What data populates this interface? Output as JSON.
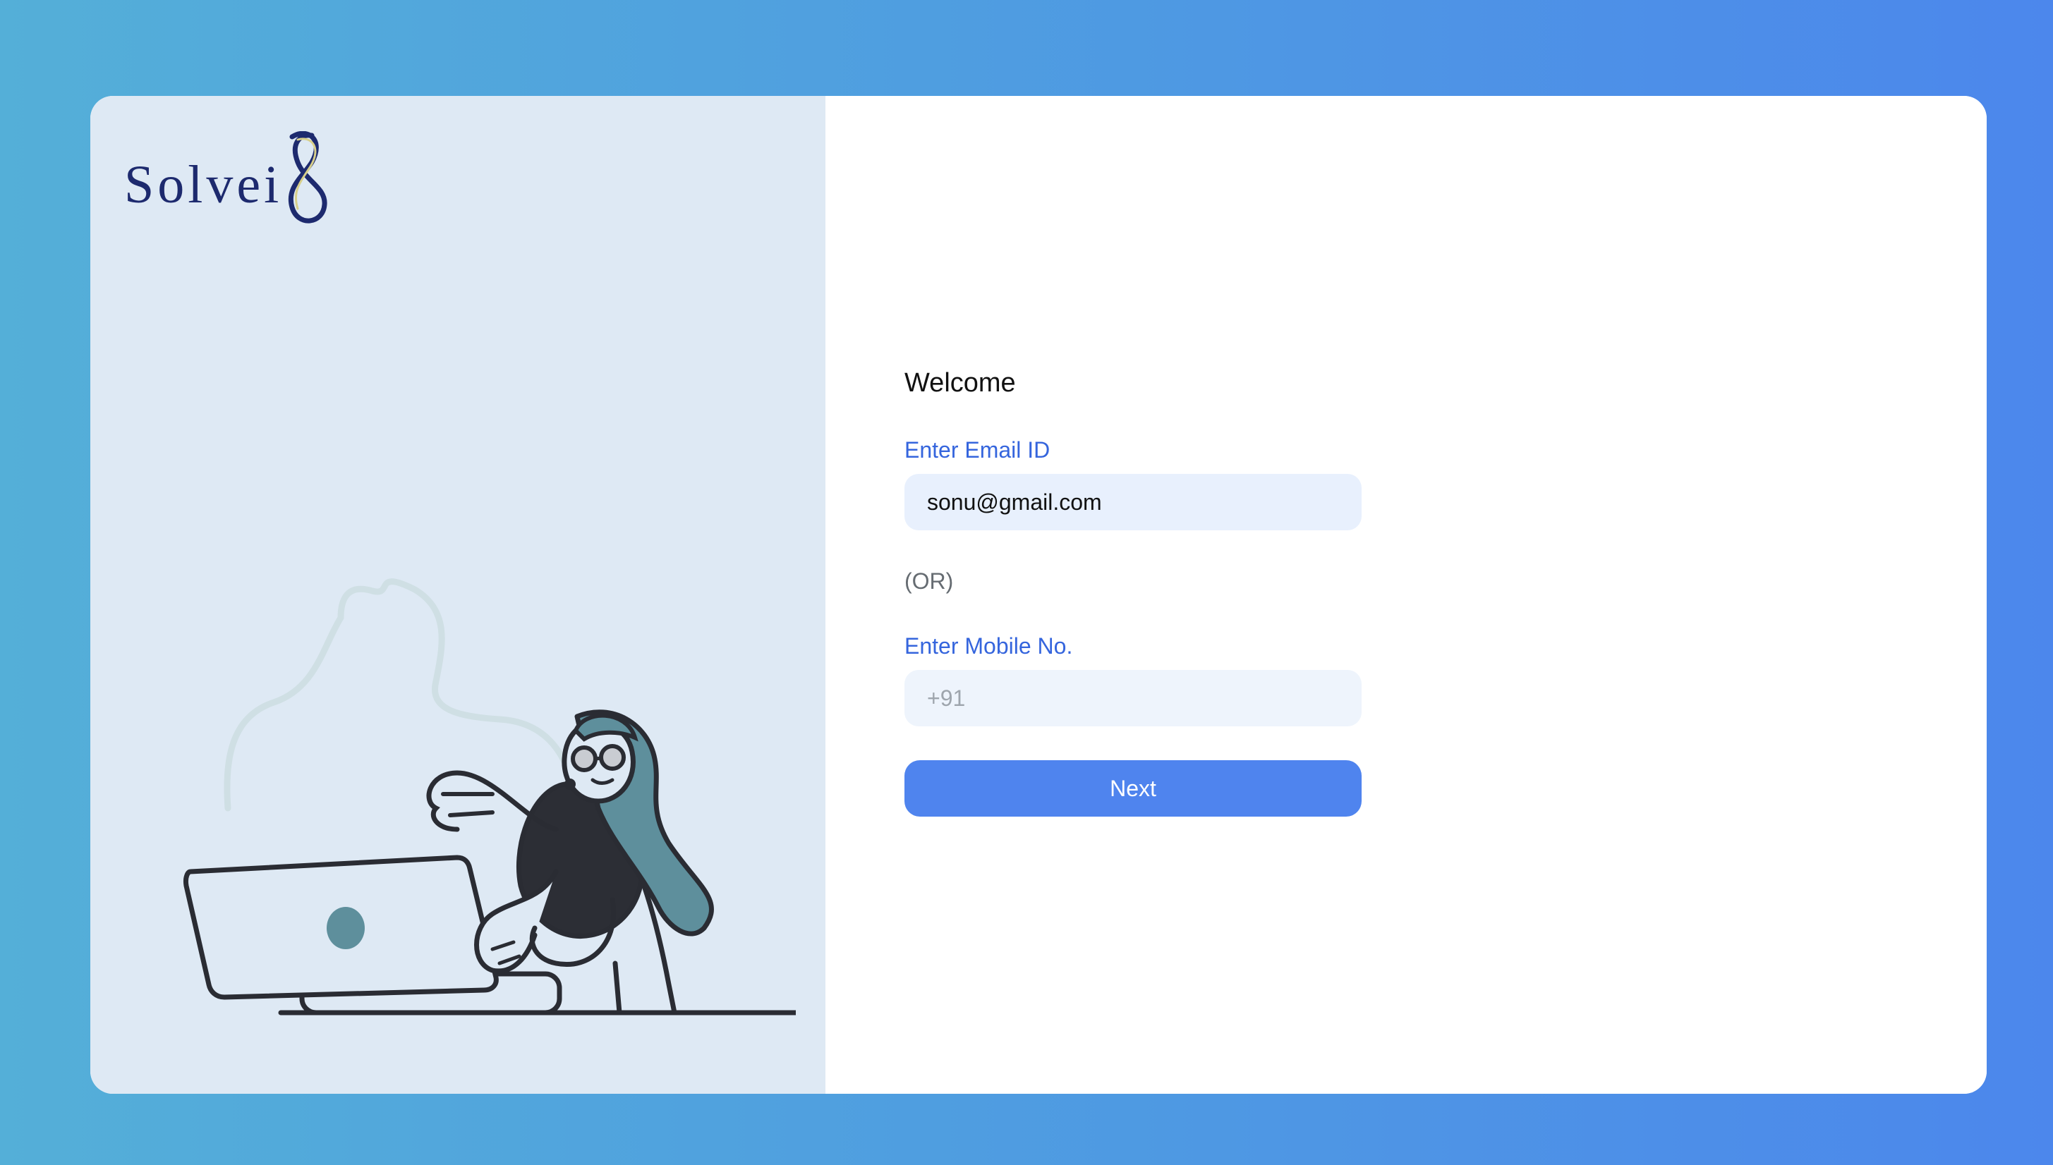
{
  "brand": {
    "name": "Solvei",
    "mark_icon": "infinity-8-mark",
    "text_color": "#1d2a6e",
    "accent_gold": "#c9a44a"
  },
  "illustration": {
    "icon": "person-working-on-laptop-illustration"
  },
  "form": {
    "welcome": "Welcome",
    "email_label": "Enter Email ID",
    "email_value": "sonu@gmail.com",
    "or_text": "(OR)",
    "mobile_label": "Enter Mobile No.",
    "mobile_placeholder": "+91",
    "mobile_value": "",
    "next_label": "Next"
  },
  "colors": {
    "label_blue": "#3565dd",
    "button_blue": "#4f84ee",
    "left_panel_bg": "#dee9f4"
  }
}
